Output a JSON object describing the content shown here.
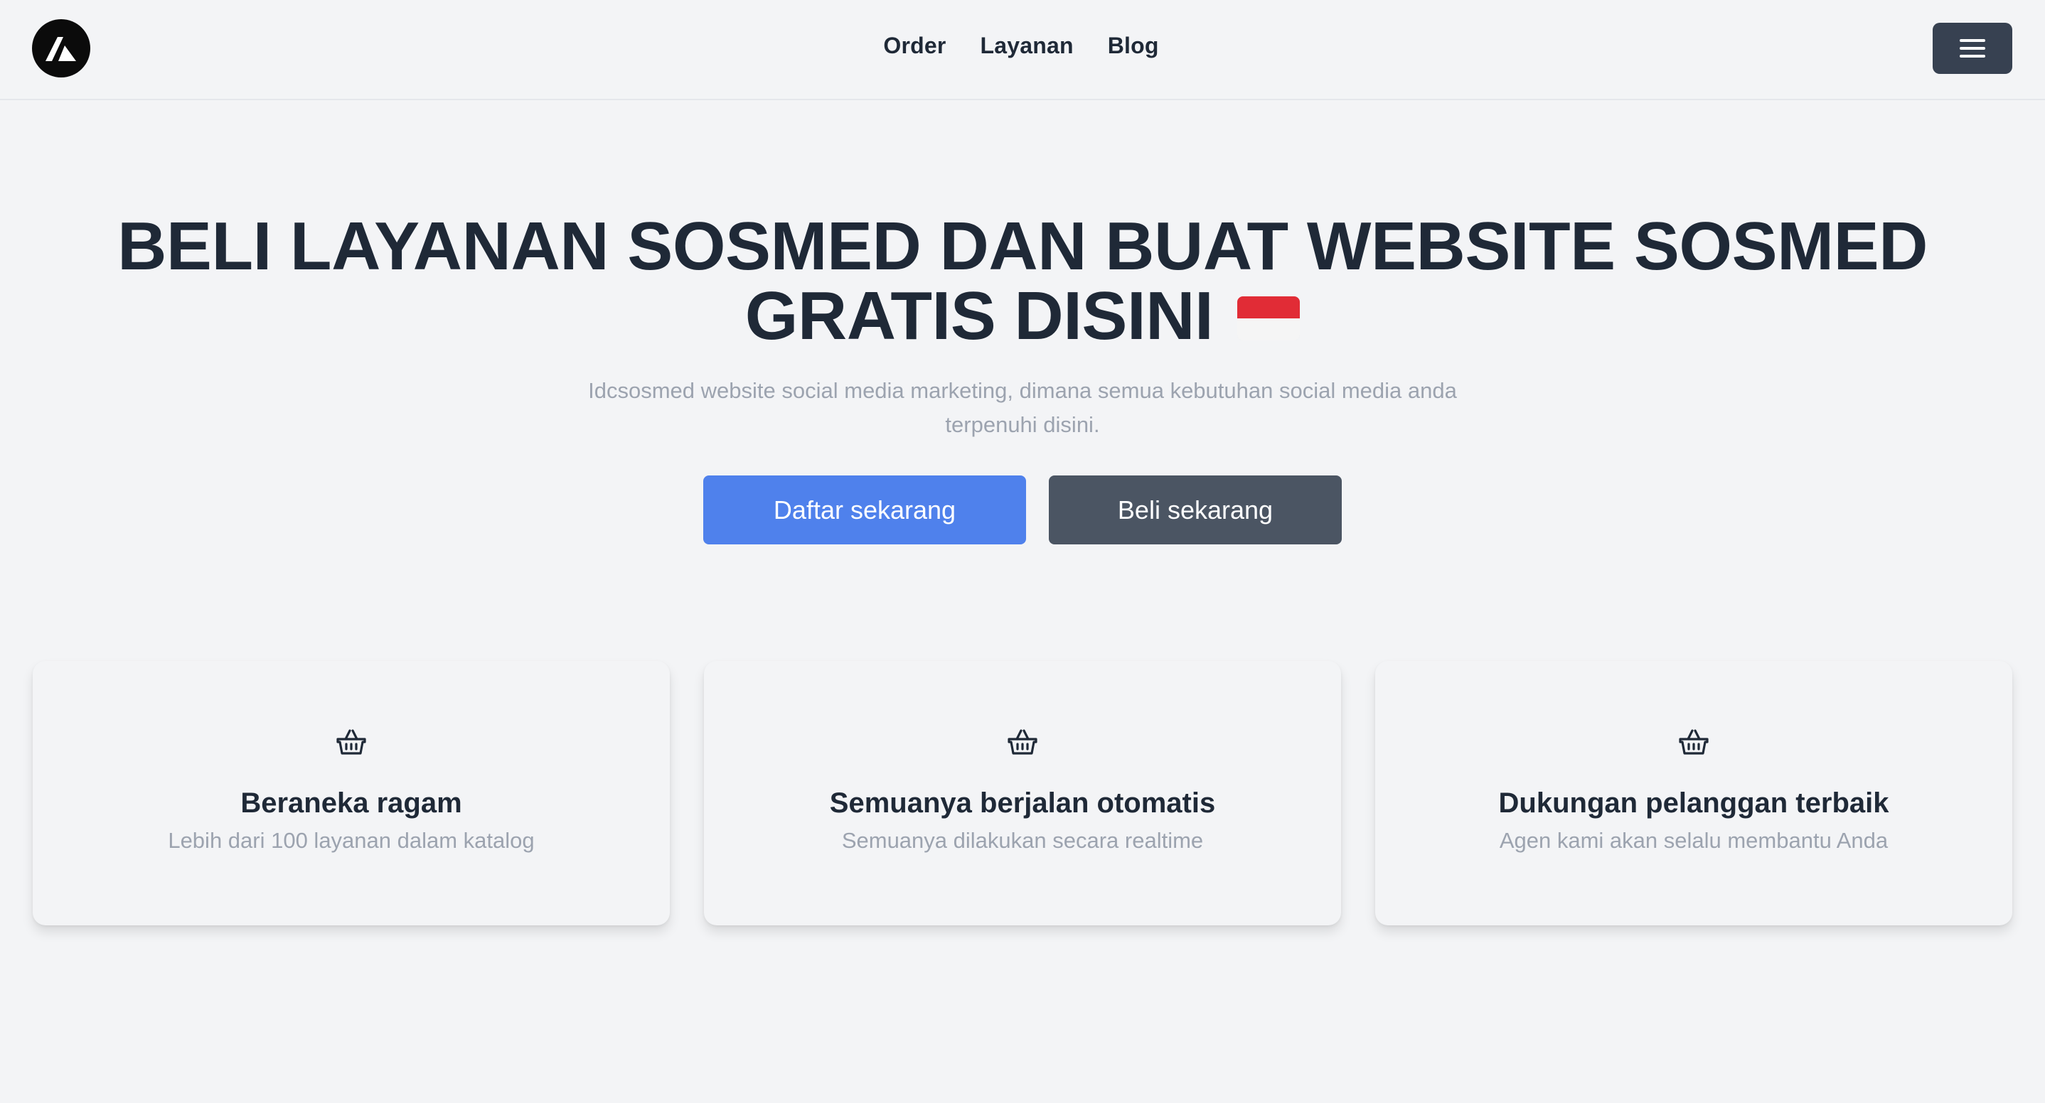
{
  "nav": {
    "links": [
      "Order",
      "Layanan",
      "Blog"
    ]
  },
  "hero": {
    "title_line1": "BELI LAYANAN SOSMED DAN BUAT WEBSITE SOSMED",
    "title_line2": "GRATIS DISINI",
    "subtitle": "Idcsosmed website social media marketing, dimana semua kebutuhan social media anda terpenuhi disini.",
    "primary_button": "Daftar sekarang",
    "secondary_button": "Beli sekarang"
  },
  "features": [
    {
      "icon": "basket-icon",
      "title": "Beraneka ragam",
      "description": "Lebih dari 100 layanan dalam katalog"
    },
    {
      "icon": "basket-icon",
      "title": "Semuanya berjalan otomatis",
      "description": "Semuanya dilakukan secara realtime"
    },
    {
      "icon": "basket-icon",
      "title": "Dukungan pelanggan terbaik",
      "description": "Agen kami akan selalu membantu Anda"
    }
  ],
  "colors": {
    "background": "#f3f4f6",
    "text_dark": "#1f2937",
    "text_muted": "#9ca3af",
    "primary_button": "#4f81ec",
    "secondary_button": "#4b5563",
    "menu_button": "#374151"
  }
}
